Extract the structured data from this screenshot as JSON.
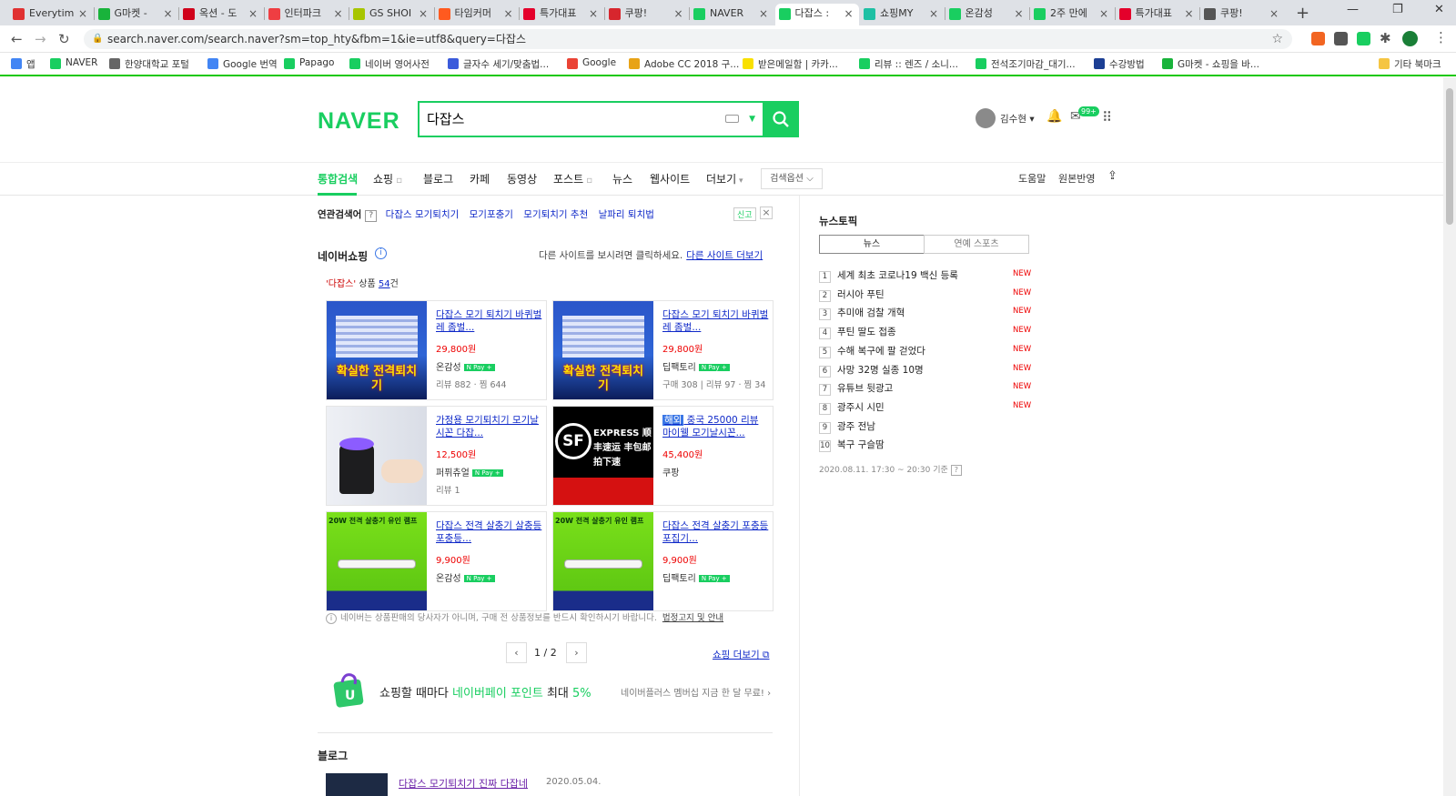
{
  "browser": {
    "tabs": [
      {
        "label": "Everytim",
        "color": "#e03131"
      },
      {
        "label": "G마켓 - ",
        "color": "#19b33b"
      },
      {
        "label": "옥션 - 도",
        "color": "#d0021b"
      },
      {
        "label": "인터파크",
        "color": "#ef3e42"
      },
      {
        "label": "GS SHOI",
        "color": "#a7c500"
      },
      {
        "label": "타임커머",
        "color": "#ff5a1f"
      },
      {
        "label": "특가대표",
        "color": "#e4002b"
      },
      {
        "label": "쿠팡!",
        "color": "#d7262d"
      },
      {
        "label": "NAVER",
        "color": "#19ce60"
      },
      {
        "label": "다잡스 :",
        "color": "#19ce60"
      },
      {
        "label": "쇼핑MY",
        "color": "#1ec0a4"
      },
      {
        "label": "온감성",
        "color": "#19ce60"
      },
      {
        "label": "2주 만에",
        "color": "#19ce60"
      },
      {
        "label": "특가대표",
        "color": "#e4002b"
      },
      {
        "label": "쿠팡!",
        "color": "#555555"
      }
    ],
    "url": "search.naver.com/search.naver?sm=top_hty&fbm=1&ie=utf8&query=다잡스",
    "bookmarks": [
      {
        "label": "앱",
        "color": "#4285f4"
      },
      {
        "label": "NAVER",
        "color": "#19ce60"
      },
      {
        "label": "한양대학교 포털",
        "color": "#666666"
      },
      {
        "label": "Google 번역",
        "color": "#4285f4"
      },
      {
        "label": "Papago",
        "color": "#19ce60"
      },
      {
        "label": "네이버 영어사전",
        "color": "#19ce60"
      },
      {
        "label": "글자수 세기/맞춤법...",
        "color": "#3b5bdb"
      },
      {
        "label": "Google",
        "color": "#ea4335"
      },
      {
        "label": "Adobe CC 2018 구...",
        "color": "#e8a317"
      },
      {
        "label": "받은메일함 | 카카...",
        "color": "#f9e000"
      },
      {
        "label": "리뷰 :: 렌즈 / 소니...",
        "color": "#19ce60"
      },
      {
        "label": "전석조기마감_대기...",
        "color": "#19ce60"
      },
      {
        "label": "수강방법",
        "color": "#1c3f94"
      },
      {
        "label": "G마켓 - 쇼핑을 바...",
        "color": "#19b33b"
      }
    ],
    "other_bookmarks": "기타 북마크"
  },
  "header": {
    "logo": "NAVER",
    "query": "다잡스",
    "user_name": "김수현",
    "mail_badge": "99+"
  },
  "lnb": {
    "tabs": [
      "통합검색",
      "쇼핑",
      "블로그",
      "카페",
      "동영상",
      "포스트",
      "뉴스",
      "웹사이트",
      "더보기"
    ],
    "search_option": "검색옵션",
    "right": [
      "도움말",
      "원본반영"
    ]
  },
  "related": {
    "label": "연관검색어",
    "help": "?",
    "items": [
      "다잡스 모기퇴치기",
      "모기포충기",
      "모기퇴치기 추천",
      "날파리 퇴치법"
    ],
    "ad": "신고"
  },
  "shopping": {
    "title": "네이버쇼핑",
    "note": "다른 사이트를 보시려면 클릭하세요.",
    "note_link": "다른 사이트 더보기",
    "count_keyword": "'다잡스'",
    "count_text": " 상품 ",
    "count_num": "54",
    "count_unit": "건",
    "products": [
      {
        "name": "다잡스 모기 퇴치기 바퀴벌레 좀벌...",
        "price": "29,800원",
        "seller": "온감성",
        "meta": "리뷰 882 · 찜 644",
        "img_text": "확실한 전격퇴치기",
        "npay": true
      },
      {
        "name": "다잡스 모기 퇴치기 바퀴벌레 좀벌...",
        "price": "29,800원",
        "seller": "딥팩토리",
        "meta": "구매 308 | 리뷰 97 · 찜 34",
        "img_text": "확실한 전격퇴치기",
        "npay": true
      },
      {
        "name": "가정용 모기퇴치기 모기날시꼰 다잡...",
        "price": "12,500원",
        "seller": "퍼퓌츄얼",
        "meta": "리뷰 1",
        "img_text": "",
        "npay": true
      },
      {
        "overseas": "해외",
        "name": " 중국 25000 리뷰 마이웰 모기날시꼰...",
        "price": "45,400원",
        "seller": "쿠팡",
        "meta": "",
        "img_text": "EXPRESS 顺丰速运 丰包邮 拍下速",
        "npay": false
      },
      {
        "name": "다잡스 전격 살충기 살충등 포충등...",
        "price": "9,900원",
        "seller": "온감성",
        "meta": "",
        "img_text": "20W 전격 살충기 유인 램프",
        "npay": true
      },
      {
        "name": "다잡스 전격 살충기 포충등 포집기...",
        "price": "9,900원",
        "seller": "딥팩토리",
        "meta": "",
        "img_text": "20W 전격 살충기 유인 램프",
        "npay": true
      }
    ],
    "npay_label": "N Pay +",
    "disclaimer": "네이버는 상품판매의 당사자가 아니며, 구매 전 상품정보를 반드시 확인하시기 바랍니다.",
    "disclaimer_link": "법정고지 및 안내",
    "page": "1 / 2",
    "more": "쇼핑 더보기"
  },
  "promo": {
    "a": "쇼핑할 때마다 ",
    "b": "네이버페이 포인트",
    "c": " 최대 ",
    "d": "5%",
    "right": "네이버플러스 멤버십 지금 한 달 무료! ›"
  },
  "blog": {
    "title": "블로그",
    "first_link": "다잡스 모기퇴치기 진짜 다잡네",
    "first_date": "2020.05.04."
  },
  "news": {
    "title": "뉴스토픽",
    "tabs": [
      "뉴스",
      "연예 스포츠"
    ],
    "items": [
      {
        "rank": "1",
        "text": "세계 최초 코로나19 백신 등록",
        "new": "NEW"
      },
      {
        "rank": "2",
        "text": "러시아 푸틴",
        "new": "NEW"
      },
      {
        "rank": "3",
        "text": "추미애 검찰 개혁",
        "new": "NEW"
      },
      {
        "rank": "4",
        "text": "푸틴 딸도 접종",
        "new": "NEW"
      },
      {
        "rank": "5",
        "text": "수해 복구에 팔 걷었다",
        "new": "NEW"
      },
      {
        "rank": "6",
        "text": "사망 32명 실종 10명",
        "new": "NEW"
      },
      {
        "rank": "7",
        "text": "유튜브 뒷광고",
        "new": "NEW"
      },
      {
        "rank": "8",
        "text": "광주시 시민",
        "new": "NEW"
      },
      {
        "rank": "9",
        "text": "광주 전남",
        "new": ""
      },
      {
        "rank": "10",
        "text": "복구 구슬땀",
        "new": ""
      }
    ],
    "time": "2020.08.11. 17:30 ~ 20:30 기준",
    "help": "?"
  }
}
